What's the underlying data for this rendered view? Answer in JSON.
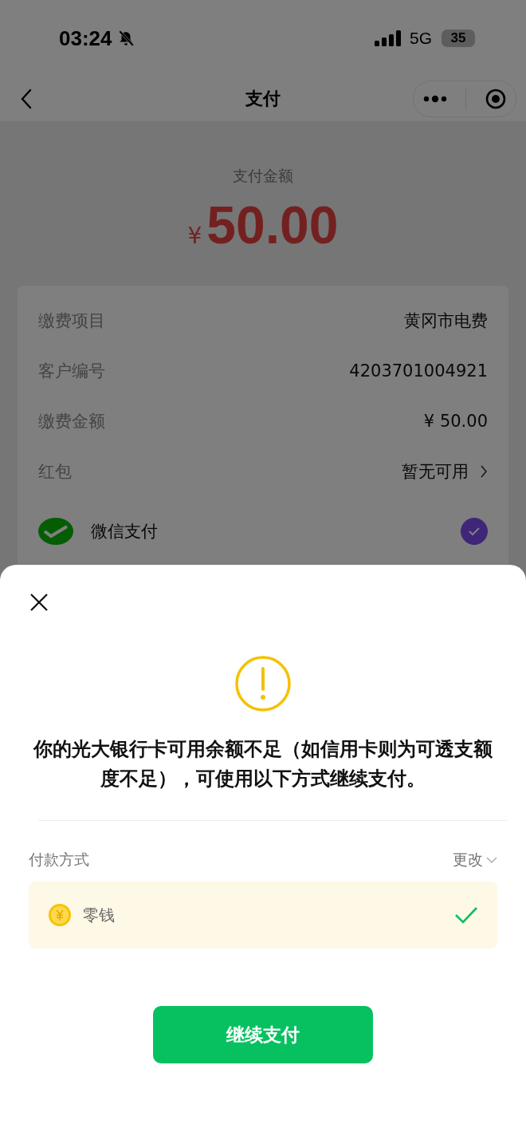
{
  "status_bar": {
    "time": "03:24",
    "network": "5G",
    "battery": "35"
  },
  "nav": {
    "title": "支付"
  },
  "amount": {
    "label": "支付金额",
    "currency": "¥",
    "value": "50.00"
  },
  "details": [
    {
      "label": "缴费项目",
      "value": "黄冈市电费",
      "kind": "text"
    },
    {
      "label": "客户编号",
      "value": "4203701004921",
      "kind": "text"
    },
    {
      "label": "缴费金额",
      "value": "¥ 50.00",
      "kind": "text"
    },
    {
      "label": "红包",
      "value": "暂无可用",
      "kind": "link"
    }
  ],
  "payment_option": {
    "label": "微信支付",
    "checked": true
  },
  "sheet": {
    "message": "你的光大银行卡可用余额不足（如信用卡则为可透支额度不足），可使用以下方式继续支付。",
    "method_label": "付款方式",
    "change": "更改",
    "methods": [
      {
        "name": "零钱",
        "selected": true
      }
    ],
    "button": "继续支付"
  }
}
